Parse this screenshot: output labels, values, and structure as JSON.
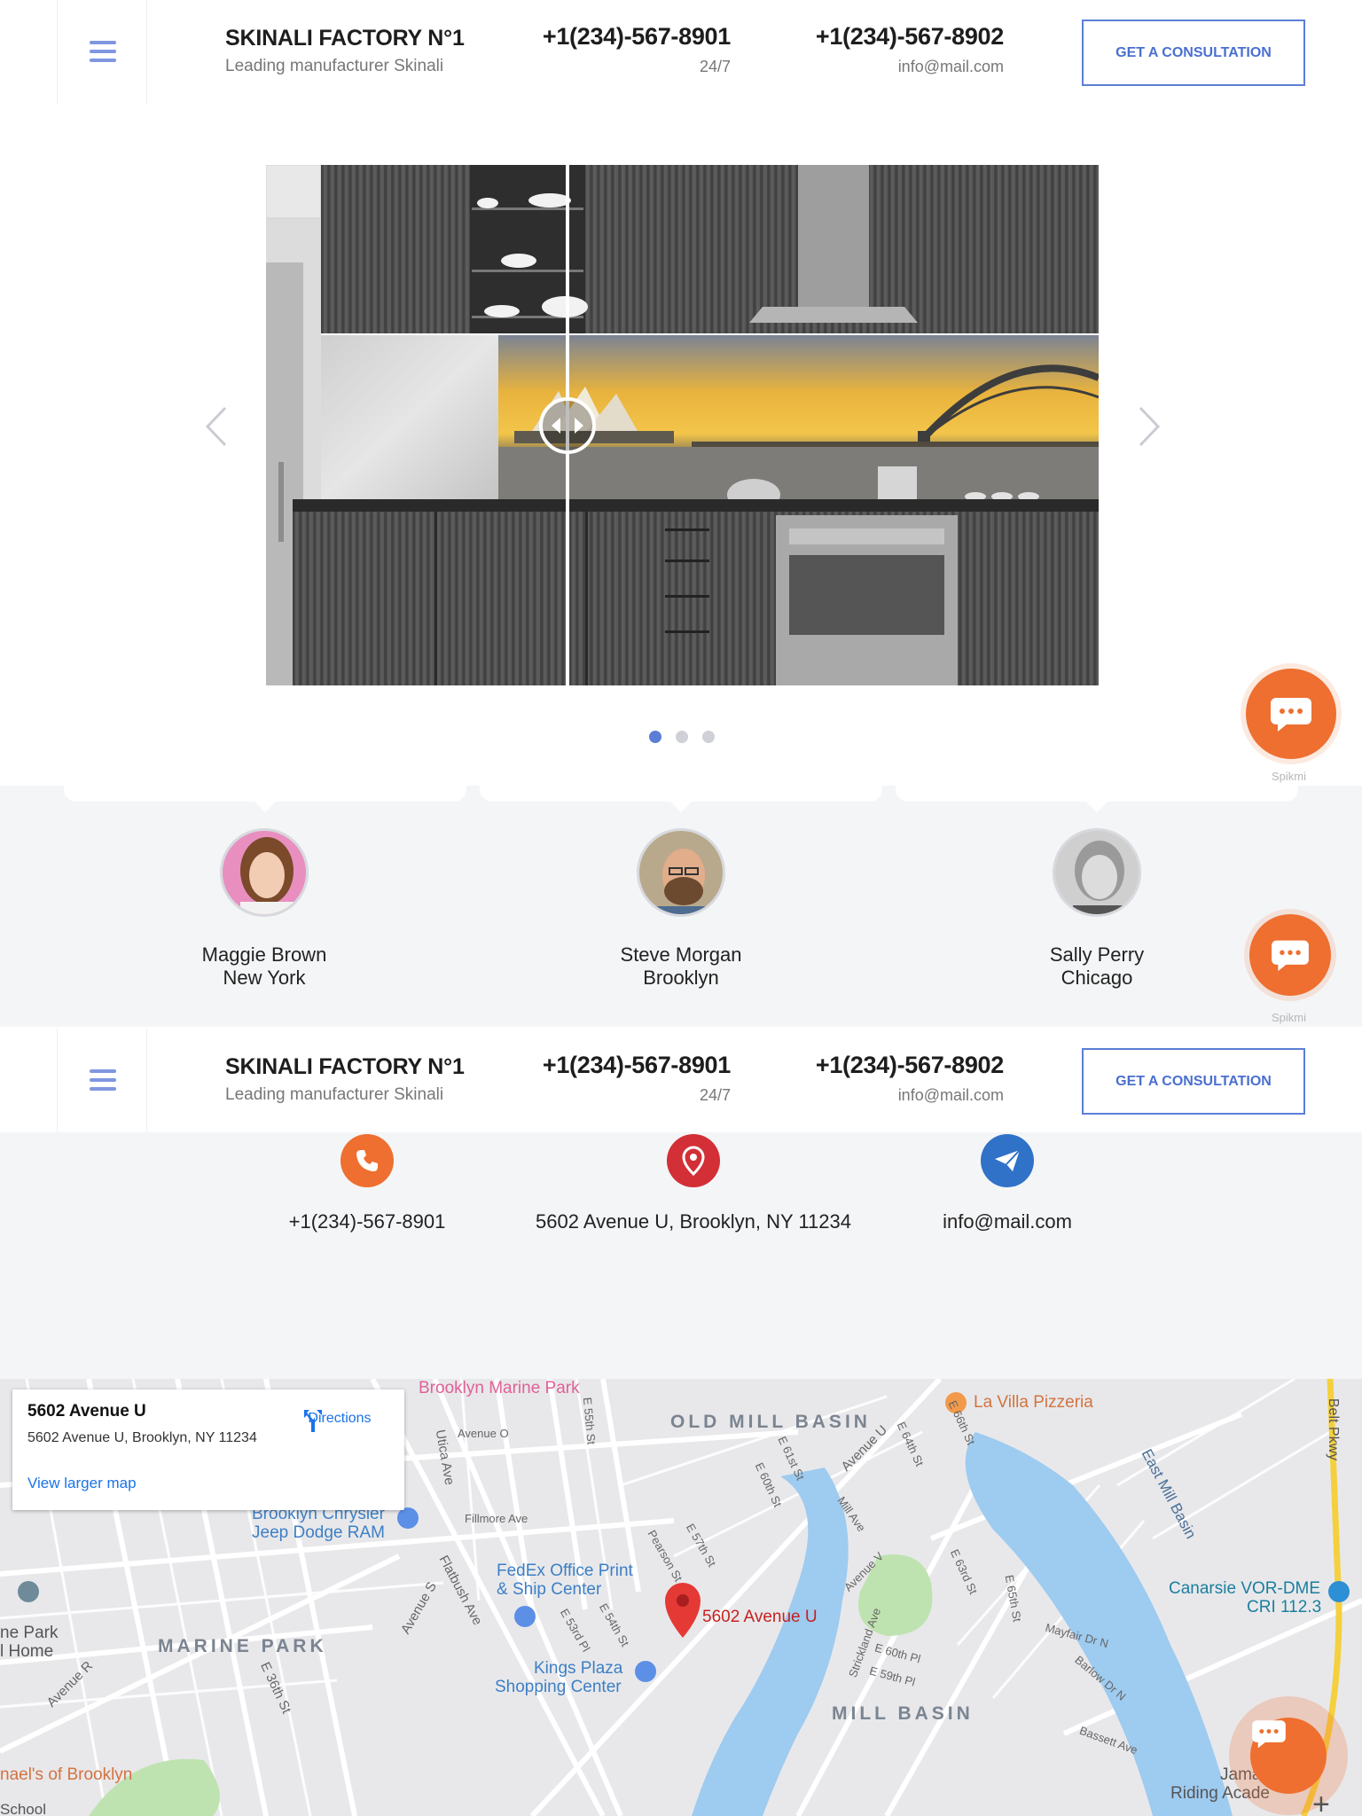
{
  "header": {
    "brand_title": "SKINALI FACTORY N°1",
    "brand_subtitle": "Leading manufacturer Skinali",
    "phone1": "+1(234)-567-8901",
    "phone1_note": "24/7",
    "phone2": "+1(234)-567-8902",
    "email": "info@mail.com",
    "cta_label": "GET A CONSULTATION"
  },
  "slider": {
    "active_index": 0,
    "dot_count": 3
  },
  "chat": {
    "label": "Spikmi"
  },
  "testimonials": [
    {
      "name": "Maggie Brown",
      "city": "New York"
    },
    {
      "name": "Steve Morgan",
      "city": "Brooklyn"
    },
    {
      "name": "Sally Perry",
      "city": "Chicago"
    }
  ],
  "contacts": {
    "phone": "+1(234)-567-8901",
    "address": "5602 Avenue U, Brooklyn, NY 11234",
    "email": "info@mail.com"
  },
  "map": {
    "card_title": "5602 Avenue U",
    "card_address": "5602 Avenue U, Brooklyn, NY 11234",
    "directions": "Directions",
    "view_larger": "View larger map",
    "marker_label": "5602 Avenue U",
    "labels": {
      "old_mill_basin": "OLD MILL BASIN",
      "marine_park": "MARINE PARK",
      "mill_basin": "MILL BASIN",
      "la_villa": "La Villa Pizzeria",
      "brooklyn_marine_park": "Brooklyn Marine Park",
      "chrysler_1": "Brooklyn Chrysler",
      "chrysler_2": "Jeep Dodge RAM",
      "fedex_1": "FedEx Office Print",
      "fedex_2": "& Ship Center",
      "kings_1": "Kings Plaza",
      "kings_2": "Shopping Center",
      "canarsie_1": "Canarsie VOR-DME",
      "canarsie_2": "CRI 112.3",
      "east_mill_basin": "East Mill Basin",
      "belt_pkwy": "Belt Pkwy",
      "flatbush": "Flatbush Ave",
      "utica": "Utica Ave",
      "avenue_u": "Avenue U",
      "avenue_s": "Avenue S",
      "avenue_r": "Avenue R",
      "avenue_o": "Avenue O",
      "avenue_v": "Avenue V",
      "fillmore": "Fillmore Ave",
      "mill_ave": "Mill Ave",
      "e36th": "E 36th St",
      "e55th": "E 55th St",
      "e60th": "E 60th St",
      "e61st": "E 61st St",
      "e64th": "E 64th St",
      "e66th": "E 66th St",
      "e63rd": "E 63rd St",
      "e65th": "E 65th St",
      "e57th": "E 57th St",
      "e54th": "E 54th St",
      "e53rd": "E 53rd Pl",
      "e60pl": "E 60th Pl",
      "e59pl": "E 59th Pl",
      "pearson": "Pearson St",
      "strickland": "Strickland Ave",
      "mayfair": "Mayfair Dr N",
      "barlow": "Barlow Dr N",
      "bassett": "Bassett Ave",
      "michaels": "nael's of Brooklyn",
      "park_home_1": "ne Park",
      "park_home_2": "l Home",
      "jamaica_1": "Jama",
      "jamaica_2": "Riding Acade",
      "school": "School"
    }
  }
}
